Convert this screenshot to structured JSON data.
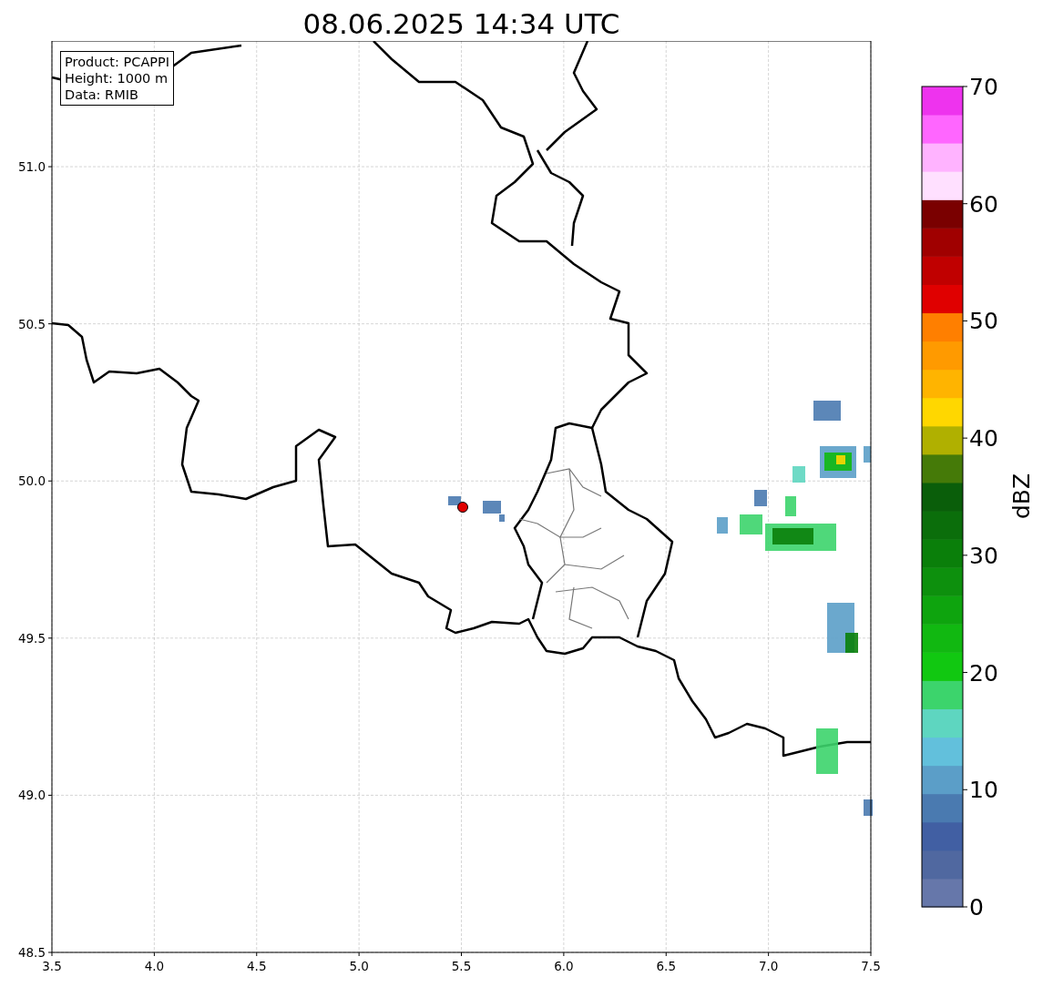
{
  "title": "08.06.2025 14:34 UTC",
  "map": {
    "info_box": [
      "Product: PCAPPI",
      "Height: 1000 m",
      "Data: RMIB"
    ],
    "xticks": [
      "3.5",
      "4.0",
      "4.5",
      "5.0",
      "5.5",
      "6.0",
      "6.5",
      "7.0",
      "7.5"
    ],
    "yticks": [
      "51.0",
      "50.5",
      "50.0",
      "49.5",
      "49.0",
      "48.5"
    ]
  },
  "colorbar": {
    "label": "dBZ",
    "ticks": [
      "70",
      "60",
      "50",
      "40",
      "30",
      "20",
      "10",
      "0"
    ],
    "bins": [
      {
        "color": "#6677aa"
      },
      {
        "color": "#5068a0"
      },
      {
        "color": "#415fa3"
      },
      {
        "color": "#4a7ab0"
      },
      {
        "color": "#5b9ec8"
      },
      {
        "color": "#62c0dc"
      },
      {
        "color": "#5ed6c0"
      },
      {
        "color": "#3cd46c"
      },
      {
        "color": "#11c811"
      },
      {
        "color": "#11b811"
      },
      {
        "color": "#0ea40e"
      },
      {
        "color": "#0d900d"
      },
      {
        "color": "#0a7f0a"
      },
      {
        "color": "#0b6e0b"
      },
      {
        "color": "#0a5e0a"
      },
      {
        "color": "#457a08"
      },
      {
        "color": "#b0b000"
      },
      {
        "color": "#ffd700"
      },
      {
        "color": "#ffb400"
      },
      {
        "color": "#ff9a00"
      },
      {
        "color": "#ff7f00"
      },
      {
        "color": "#e00000"
      },
      {
        "color": "#c00000"
      },
      {
        "color": "#a00000"
      },
      {
        "color": "#7a0000"
      },
      {
        "color": "#ffe0ff"
      },
      {
        "color": "#ffb3ff"
      },
      {
        "color": "#ff66ff"
      },
      {
        "color": "#ee33ee"
      }
    ]
  }
}
